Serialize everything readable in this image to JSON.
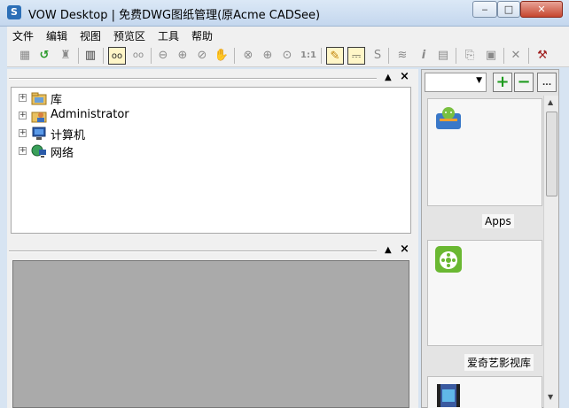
{
  "window": {
    "title": "VOW Desktop | 免费DWG图纸管理(原Acme CADSee)",
    "icon": "app-logo-icon",
    "minimize_glyph": "‒",
    "maximize_glyph": "□",
    "close_glyph": "✕"
  },
  "menu": {
    "items": [
      {
        "label": "文件"
      },
      {
        "label": "编辑"
      },
      {
        "label": "视图"
      },
      {
        "label": "预览区"
      },
      {
        "label": "工具"
      },
      {
        "label": "帮助"
      }
    ]
  },
  "toolbar": {
    "buttons": [
      {
        "name": "folder-icon",
        "glyph": "▦"
      },
      {
        "name": "refresh-icon",
        "glyph": "↺"
      },
      {
        "name": "binoculars-icon",
        "glyph": "♜"
      },
      {
        "name": "layout-icon",
        "glyph": "▥"
      },
      {
        "name": "single-view-icon",
        "glyph": "oo"
      },
      {
        "name": "dual-view-icon",
        "glyph": "oo"
      },
      {
        "name": "zoom-out-icon",
        "glyph": "⊖"
      },
      {
        "name": "zoom-in-icon",
        "glyph": "⊕"
      },
      {
        "name": "zoom-window-icon",
        "glyph": "⊘"
      },
      {
        "name": "pan-icon",
        "glyph": "✋"
      },
      {
        "name": "zoom-extent-icon",
        "glyph": "⊗"
      },
      {
        "name": "zoom-prev-icon",
        "glyph": "⊕"
      },
      {
        "name": "zoom-all-icon",
        "glyph": "⊙"
      },
      {
        "name": "actual-size-icon",
        "glyph": "1:1"
      },
      {
        "name": "measure-icon",
        "glyph": "✎"
      },
      {
        "name": "layer-icon",
        "glyph": "⎓"
      },
      {
        "name": "text-icon",
        "glyph": "S"
      },
      {
        "name": "stack-icon",
        "glyph": "≋"
      },
      {
        "name": "info-icon",
        "glyph": "i"
      },
      {
        "name": "print-icon",
        "glyph": "▤"
      },
      {
        "name": "copy-icon",
        "glyph": "⎘"
      },
      {
        "name": "paste-icon",
        "glyph": "▣"
      },
      {
        "name": "delete-icon",
        "glyph": "✕"
      },
      {
        "name": "tools-icon",
        "glyph": "⚒"
      }
    ]
  },
  "tree": {
    "panel_pin": "▲",
    "panel_close": "×",
    "expander": "+",
    "items": [
      {
        "label": "库",
        "icon": "library-folder-icon"
      },
      {
        "label": "Administrator",
        "icon": "user-folder-icon"
      },
      {
        "label": "计算机",
        "icon": "computer-icon"
      },
      {
        "label": "网络",
        "icon": "network-icon"
      }
    ]
  },
  "preview": {
    "panel_pin": "▲",
    "panel_close": "×"
  },
  "right_panel": {
    "combo_value": "",
    "combo_arrow": "▼",
    "add_glyph": "+",
    "remove_glyph": "−",
    "more_glyph": "...",
    "tiles": [
      {
        "label": "Apps",
        "icon": "apps-android-icon"
      },
      {
        "label": "爱奇艺影视库",
        "icon": "iqiyi-film-icon"
      },
      {
        "label": "",
        "icon": "video-film-icon"
      }
    ],
    "scroll_up": "▲",
    "scroll_down": "▼"
  }
}
